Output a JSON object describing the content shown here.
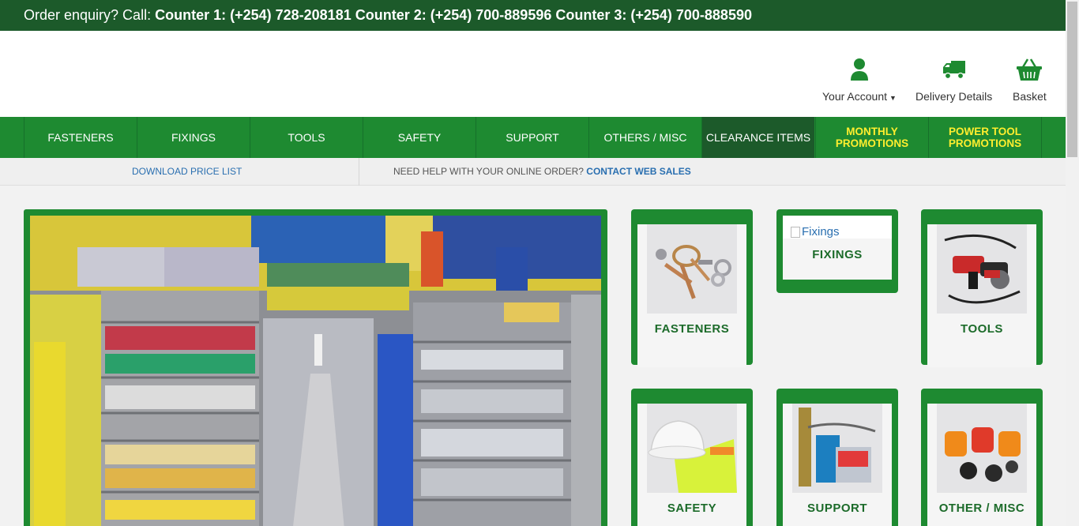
{
  "topbar": {
    "label": "Order enquiry? Call:",
    "counters": "Counter 1: (+254) 728-208181 Counter 2: (+254) 700-889596 Counter 3: (+254) 700-888590"
  },
  "header": {
    "account": "Your Account",
    "delivery": "Delivery Details",
    "basket": "Basket"
  },
  "nav": {
    "items": [
      "FASTENERS",
      "FIXINGS",
      "TOOLS",
      "SAFETY",
      "SUPPORT",
      "OTHERS / MISC",
      "CLEARANCE ITEMS"
    ],
    "promos": [
      "MONTHLY PROMOTIONS",
      "POWER TOOL PROMOTIONS"
    ]
  },
  "subbar": {
    "download": "DOWNLOAD PRICE LIST",
    "help": "NEED HELP WITH YOUR ONLINE ORDER?",
    "contact": "CONTACT WEB SALES"
  },
  "categories": {
    "fasteners": "FASTENERS",
    "fixings": "FIXINGS",
    "fixings_alt": "Fixings",
    "tools": "TOOLS",
    "safety": "SAFETY",
    "support": "SUPPORT",
    "other": "OTHER / MISC"
  },
  "colors": {
    "brand_green": "#1e8a31",
    "dark_green": "#1c5a2a",
    "promo_yellow": "#ffee2e",
    "link_blue": "#2a6fb0"
  }
}
